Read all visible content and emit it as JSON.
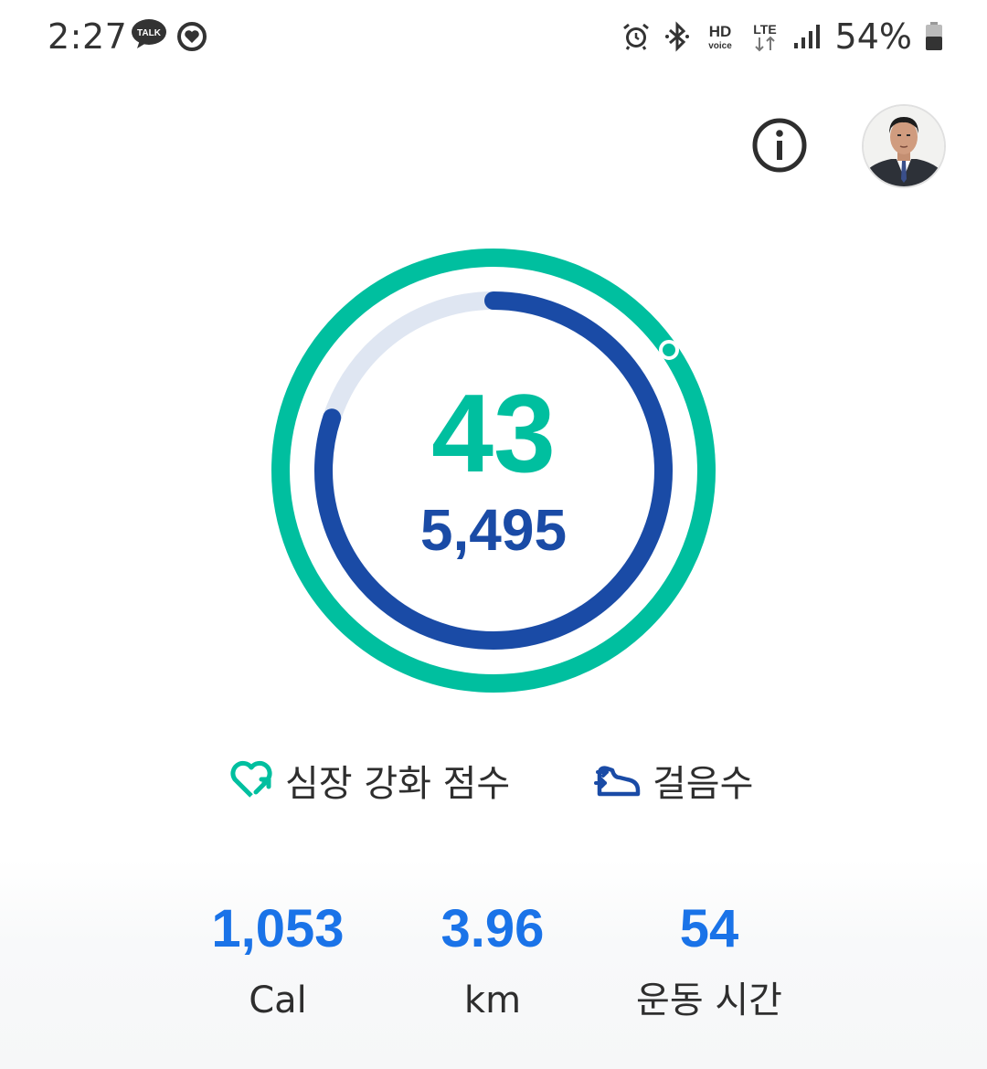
{
  "status_bar": {
    "time": "2:27",
    "notification_icons": [
      "kakaotalk-icon",
      "samsung-health-icon"
    ],
    "system_icons": [
      "alarm-icon",
      "bluetooth-icon",
      "hd-voice-icon",
      "lte-icon",
      "signal-icon",
      "battery-icon"
    ],
    "hd_label": "HD",
    "voice_label": "voice",
    "lte_label": "LTE",
    "talk_label": "TALK",
    "battery": "54%"
  },
  "header": {
    "info_icon": "info-icon",
    "avatar": "profile-avatar"
  },
  "summary": {
    "heart_points": "43",
    "steps": "5,495",
    "heart_points_goal_fraction": 1.0,
    "steps_goal_fraction": 0.8
  },
  "legend": {
    "heart_points_label": "심장 강화 점수",
    "heart_points_icon": "heart-points-icon",
    "steps_label": "걸음수",
    "steps_icon": "steps-shoe-icon"
  },
  "stats": [
    {
      "value": "1,053",
      "label": "Cal"
    },
    {
      "value": "3.96",
      "label": "km"
    },
    {
      "value": "54",
      "label": "운동 시간"
    }
  ],
  "colors": {
    "heart_points": "#00bf9f",
    "steps": "#1a4ba6",
    "steps_track": "#dfe6f2",
    "stat_value": "#1a73e8"
  }
}
